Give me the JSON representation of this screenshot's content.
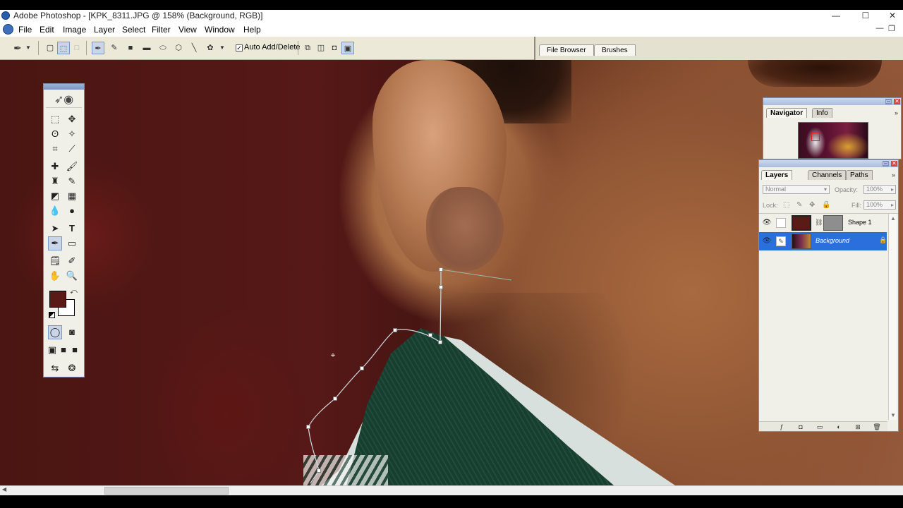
{
  "window": {
    "title": "Adobe Photoshop - [KPK_8311.JPG @ 158% (Background, RGB)]",
    "minimize": "—",
    "maximize": "☐",
    "close": "✕",
    "doc_minimize": "—",
    "doc_restore": "❐",
    "doc_close": "✕"
  },
  "menu": [
    "File",
    "Edit",
    "Image",
    "Layer",
    "Select",
    "Filter",
    "View",
    "Window",
    "Help"
  ],
  "options_bar": {
    "tool_icon": "pen-icon",
    "auto_add_delete_label": "Auto Add/Delete",
    "auto_add_delete_checked": true
  },
  "palette_well": {
    "tabs": [
      "File Browser",
      "Brushes"
    ]
  },
  "navigator_palette": {
    "tabs": [
      "Navigator",
      "Info"
    ],
    "active_tab": "Navigator"
  },
  "layers_palette": {
    "tabs": [
      "Layers",
      "Channels",
      "Paths"
    ],
    "active_tab": "Layers",
    "blend_mode": "Normal",
    "opacity_label": "Opacity:",
    "opacity_value": "100%",
    "lock_label": "Lock:",
    "fill_label": "Fill:",
    "fill_value": "100%",
    "layers": [
      {
        "name": "Shape 1",
        "visible": true,
        "selected": false,
        "locked": false
      },
      {
        "name": "Background",
        "visible": true,
        "selected": true,
        "locked": true
      }
    ]
  },
  "toolbox": {
    "foreground_color": "#5a1a16",
    "background_color": "#ffffff",
    "active_tool": "pen-tool"
  },
  "colors": {
    "selection_blue": "#2a6fdc",
    "chrome": "#ece9d8"
  }
}
